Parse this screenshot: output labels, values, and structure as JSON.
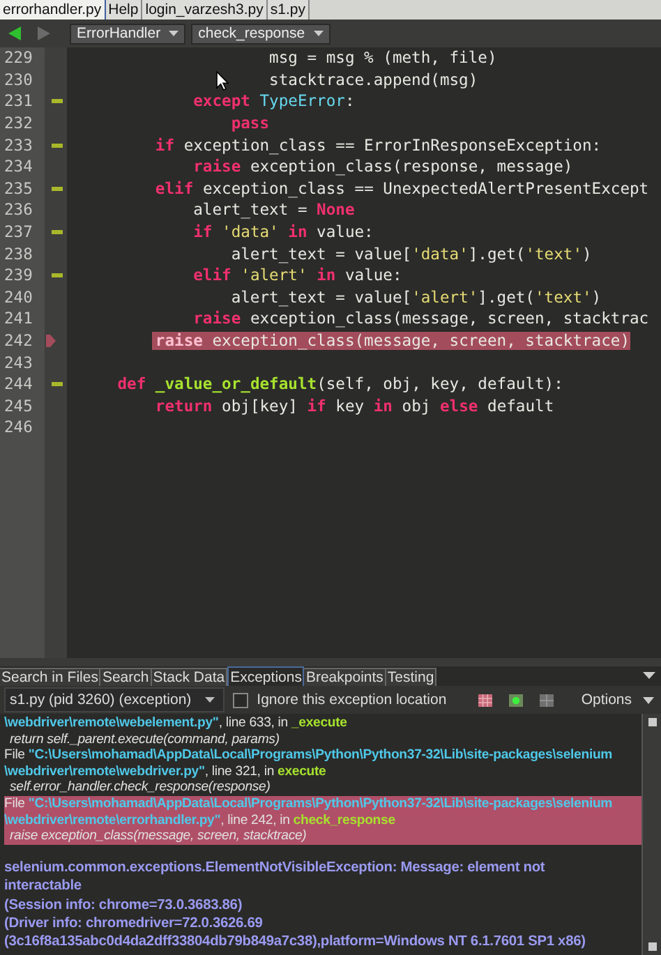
{
  "file_tabs": [
    {
      "label": "errorhandler.py",
      "selected": true
    },
    {
      "label": "Help",
      "selected": false
    },
    {
      "label": "login_varzesh3.py",
      "selected": false
    },
    {
      "label": "s1.py",
      "selected": false
    }
  ],
  "toolbar": {
    "scope_class": "ErrorHandler",
    "scope_function": "check_response"
  },
  "editor": {
    "lines": [
      {
        "number": "229",
        "fold": false,
        "current": false,
        "tokens": [
          {
            "kind": "plain",
            "text": "                    msg = msg % (meth, file)"
          }
        ]
      },
      {
        "number": "230",
        "fold": false,
        "current": false,
        "tokens": [
          {
            "kind": "plain",
            "text": "                    stacktrace.append(msg)"
          }
        ]
      },
      {
        "number": "231",
        "fold": true,
        "current": false,
        "tokens": [
          {
            "kind": "keyword",
            "text": "            except"
          },
          {
            "kind": "builtin",
            "text": " TypeError"
          },
          {
            "kind": "plain",
            "text": ":"
          }
        ]
      },
      {
        "number": "232",
        "fold": false,
        "current": false,
        "tokens": [
          {
            "kind": "keyword",
            "text": "                pass"
          }
        ]
      },
      {
        "number": "233",
        "fold": true,
        "current": false,
        "tokens": [
          {
            "kind": "keyword",
            "text": "        if"
          },
          {
            "kind": "plain",
            "text": " exception_class == ErrorInResponseException:"
          }
        ]
      },
      {
        "number": "234",
        "fold": false,
        "current": false,
        "tokens": [
          {
            "kind": "keyword",
            "text": "            raise"
          },
          {
            "kind": "plain",
            "text": " exception_class(response, message)"
          }
        ]
      },
      {
        "number": "235",
        "fold": true,
        "current": false,
        "tokens": [
          {
            "kind": "keyword",
            "text": "        elif"
          },
          {
            "kind": "plain",
            "text": " exception_class == UnexpectedAlertPresentExcept"
          }
        ]
      },
      {
        "number": "236",
        "fold": false,
        "current": false,
        "tokens": [
          {
            "kind": "plain",
            "text": "            alert_text = "
          },
          {
            "kind": "keyword",
            "text": "None"
          }
        ]
      },
      {
        "number": "237",
        "fold": true,
        "current": false,
        "tokens": [
          {
            "kind": "keyword",
            "text": "            if"
          },
          {
            "kind": "string",
            "text": " 'data'"
          },
          {
            "kind": "keyword",
            "text": " in"
          },
          {
            "kind": "plain",
            "text": " value:"
          }
        ]
      },
      {
        "number": "238",
        "fold": false,
        "current": false,
        "tokens": [
          {
            "kind": "plain",
            "text": "                alert_text = value["
          },
          {
            "kind": "string",
            "text": "'data'"
          },
          {
            "kind": "plain",
            "text": "].get("
          },
          {
            "kind": "string",
            "text": "'text'"
          },
          {
            "kind": "plain",
            "text": ")"
          }
        ]
      },
      {
        "number": "239",
        "fold": true,
        "current": false,
        "tokens": [
          {
            "kind": "keyword",
            "text": "            elif"
          },
          {
            "kind": "string",
            "text": " 'alert'"
          },
          {
            "kind": "keyword",
            "text": " in"
          },
          {
            "kind": "plain",
            "text": " value:"
          }
        ]
      },
      {
        "number": "240",
        "fold": false,
        "current": false,
        "tokens": [
          {
            "kind": "plain",
            "text": "                alert_text = value["
          },
          {
            "kind": "string",
            "text": "'alert'"
          },
          {
            "kind": "plain",
            "text": "].get("
          },
          {
            "kind": "string",
            "text": "'text'"
          },
          {
            "kind": "plain",
            "text": ")"
          }
        ]
      },
      {
        "number": "241",
        "fold": false,
        "current": false,
        "tokens": [
          {
            "kind": "keyword",
            "text": "            raise"
          },
          {
            "kind": "plain",
            "text": " exception_class(message, screen, stacktrac"
          }
        ]
      },
      {
        "number": "242",
        "fold": false,
        "current": true,
        "tokens": [
          {
            "kind": "keyword",
            "text": "        raise"
          },
          {
            "kind": "plain",
            "text": " exception_class(message, screen, stacktrace)"
          }
        ]
      },
      {
        "number": "243",
        "fold": false,
        "current": false
      },
      {
        "number": "244",
        "fold": true,
        "current": false,
        "tokens": [
          {
            "kind": "keyword",
            "text": "    def"
          },
          {
            "kind": "function",
            "text": " _value_or_default"
          },
          {
            "kind": "plain",
            "text": "(self, obj, key, default):"
          }
        ]
      },
      {
        "number": "245",
        "fold": false,
        "current": false,
        "tokens": [
          {
            "kind": "keyword",
            "text": "        return"
          },
          {
            "kind": "plain",
            "text": " obj[key] "
          },
          {
            "kind": "keyword",
            "text": "if"
          },
          {
            "kind": "plain",
            "text": " key "
          },
          {
            "kind": "keyword",
            "text": "in"
          },
          {
            "kind": "plain",
            "text": " obj "
          },
          {
            "kind": "keyword",
            "text": "else"
          },
          {
            "kind": "plain",
            "text": " default"
          }
        ]
      },
      {
        "number": "246",
        "fold": false,
        "current": false
      }
    ]
  },
  "panel": {
    "tabs": [
      {
        "label": "Search in Files",
        "selected": false
      },
      {
        "label": "Search",
        "selected": false
      },
      {
        "label": "Stack Data",
        "selected": false
      },
      {
        "label": "Exceptions",
        "selected": true
      },
      {
        "label": "Breakpoints",
        "selected": false
      },
      {
        "label": "Testing",
        "selected": false
      }
    ],
    "process": "s1.py (pid 3260) (exception)",
    "ignore_location": {
      "label": "Ignore this exception location",
      "checked": false
    },
    "options": "Options",
    "trace": [
      {
        "highlighted": false,
        "lines": [
          [
            {
              "kind": "path",
              "text": "\\webdriver\\remote\\webelement.py\""
            },
            {
              "kind": "plain",
              "text": ", line 633, in "
            },
            {
              "kind": "func",
              "text": "_execute"
            }
          ],
          [
            {
              "kind": "code",
              "text": "return self._parent.execute(command, params)"
            }
          ]
        ]
      },
      {
        "highlighted": false,
        "lines": [
          [
            {
              "kind": "plain",
              "text": "File "
            },
            {
              "kind": "path",
              "text": "\"C:\\Users\\mohamad\\AppData\\Local\\Programs\\Python\\Python37-32\\Lib\\site-packages\\selenium"
            }
          ],
          [
            {
              "kind": "path",
              "text": "\\webdriver\\remote\\webdriver.py\""
            },
            {
              "kind": "plain",
              "text": ", line 321, in "
            },
            {
              "kind": "func",
              "text": "execute"
            }
          ],
          [
            {
              "kind": "code",
              "text": "self.error_handler.check_response(response)"
            }
          ]
        ]
      },
      {
        "highlighted": true,
        "lines": [
          [
            {
              "kind": "plain",
              "text": "File "
            },
            {
              "kind": "path",
              "text": "\"C:\\Users\\mohamad\\AppData\\Local\\Programs\\Python\\Python37-32\\Lib\\site-packages\\selenium"
            }
          ],
          [
            {
              "kind": "path",
              "text": "\\webdriver\\remote\\errorhandler.py\""
            },
            {
              "kind": "plain",
              "text": ", line 242, in "
            },
            {
              "kind": "func",
              "text": "check_response"
            }
          ],
          [
            {
              "kind": "code",
              "text": "raise exception_class(message, screen, stacktrace)"
            }
          ]
        ]
      }
    ],
    "message": "selenium.common.exceptions.ElementNotVisibleException: Message: element not interactable\n(Session info: chrome=73.0.3683.86)\n(Driver info: chromedriver=72.0.3626.69\n(3c16f8a135abc0d4da2dff33804db79b849a7c38),platform=Windows NT 6.1.7601 SP1 x86)"
  }
}
